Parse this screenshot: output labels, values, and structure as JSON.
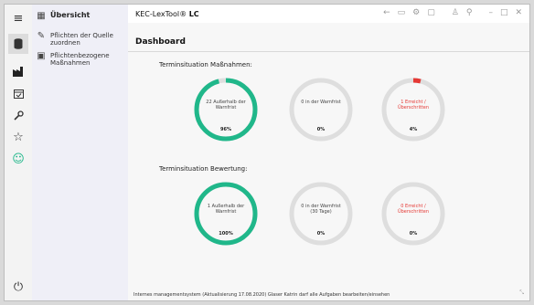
{
  "app": {
    "title_prefix": "KEC-LexTool®",
    "title_suffix": "LC",
    "page_title": "Dashboard"
  },
  "nav": {
    "header": "Übersicht",
    "items": [
      {
        "label": "Pflichten der Quelle zuordnen"
      },
      {
        "label": "Pflichtenbezogene Maßnahmen"
      }
    ]
  },
  "sections": [
    {
      "label": "Terminsituation Maßnahmen:",
      "gauges": [
        {
          "text": "22 Außerhalb der Warnfrist",
          "percent": "96%",
          "value": 96,
          "color": "#20b78a",
          "alert": false
        },
        {
          "text": "0 in der Warnfrist",
          "percent": "0%",
          "value": 0,
          "color": "#20b78a",
          "alert": false
        },
        {
          "text": "1 Erreicht / Überschritten",
          "percent": "4%",
          "value": 4,
          "color": "#e53935",
          "alert": true
        }
      ]
    },
    {
      "label": "Terminsituation Bewertung:",
      "gauges": [
        {
          "text": "1 Außerhalb der Warnfrist",
          "percent": "100%",
          "value": 100,
          "color": "#20b78a",
          "alert": false
        },
        {
          "text": "0 in der Warnfrist (30 Tage)",
          "percent": "0%",
          "value": 0,
          "color": "#20b78a",
          "alert": false
        },
        {
          "text": "0 Erreicht / Überschritten",
          "percent": "0%",
          "value": 0,
          "color": "#e53935",
          "alert": true
        }
      ]
    }
  ],
  "footer": "Internes managementsystem (Aktualisierung 17.08.2020) Glaser Katrin darf alle Aufgaben bearbeiten/einsehen",
  "colors": {
    "ring_track": "#dedede",
    "ok": "#20b78a",
    "alert": "#e53935"
  }
}
